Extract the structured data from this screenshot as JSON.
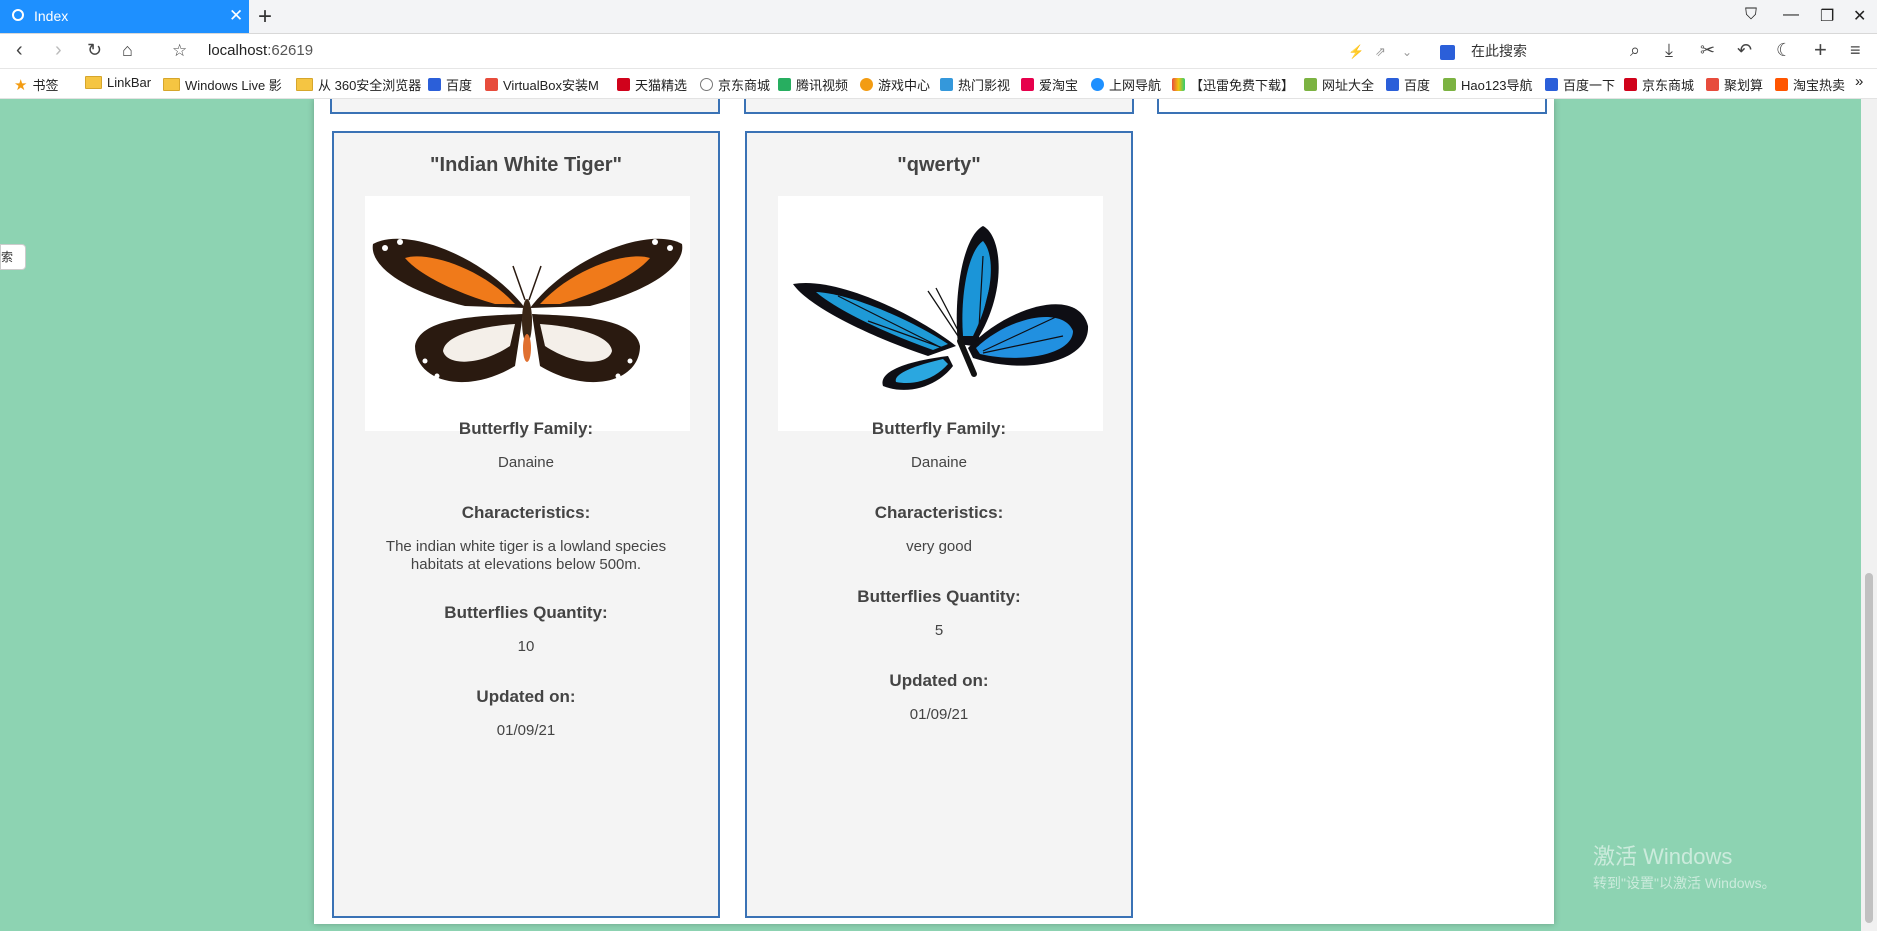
{
  "browser": {
    "tab_title": "Index",
    "url_host": "localhost",
    "url_port": ":62619",
    "search_placeholder": "在此搜索"
  },
  "bookmarks": [
    "书签",
    "LinkBar",
    "Windows Live 影",
    "从 360安全浏览器",
    "百度",
    "VirtualBox安装M",
    "天猫精选",
    "京东商城",
    "腾讯视频",
    "游戏中心",
    "热门影视",
    "爱淘宝",
    "上网导航",
    "【迅雷免费下载】",
    "网址大全",
    "百度",
    "Hao123导航",
    "百度一下",
    "京东商城",
    "聚划算",
    "淘宝热卖"
  ],
  "side_tab_label": "搜索",
  "labels": {
    "family": "Butterfly Family:",
    "characteristics": "Characteristics:",
    "quantity": "Butterflies Quantity:",
    "updated": "Updated on:"
  },
  "cards": [
    {
      "name": "\"Indian White Tiger\"",
      "family": "Danaine",
      "characteristics": "The indian white tiger is a lowland species habitats at elevations below 500m.",
      "quantity": "10",
      "updated": "01/09/21"
    },
    {
      "name": "\"qwerty\"",
      "family": "Danaine",
      "characteristics": "very good",
      "quantity": "5",
      "updated": "01/09/21"
    }
  ],
  "watermark": {
    "line1": "激活 Windows",
    "line2": "转到\"设置\"以激活 Windows。"
  },
  "colors": {
    "accent_tab": "#1e90ff",
    "page_bg": "#8dd3b2",
    "card_border": "#3a72b5"
  }
}
